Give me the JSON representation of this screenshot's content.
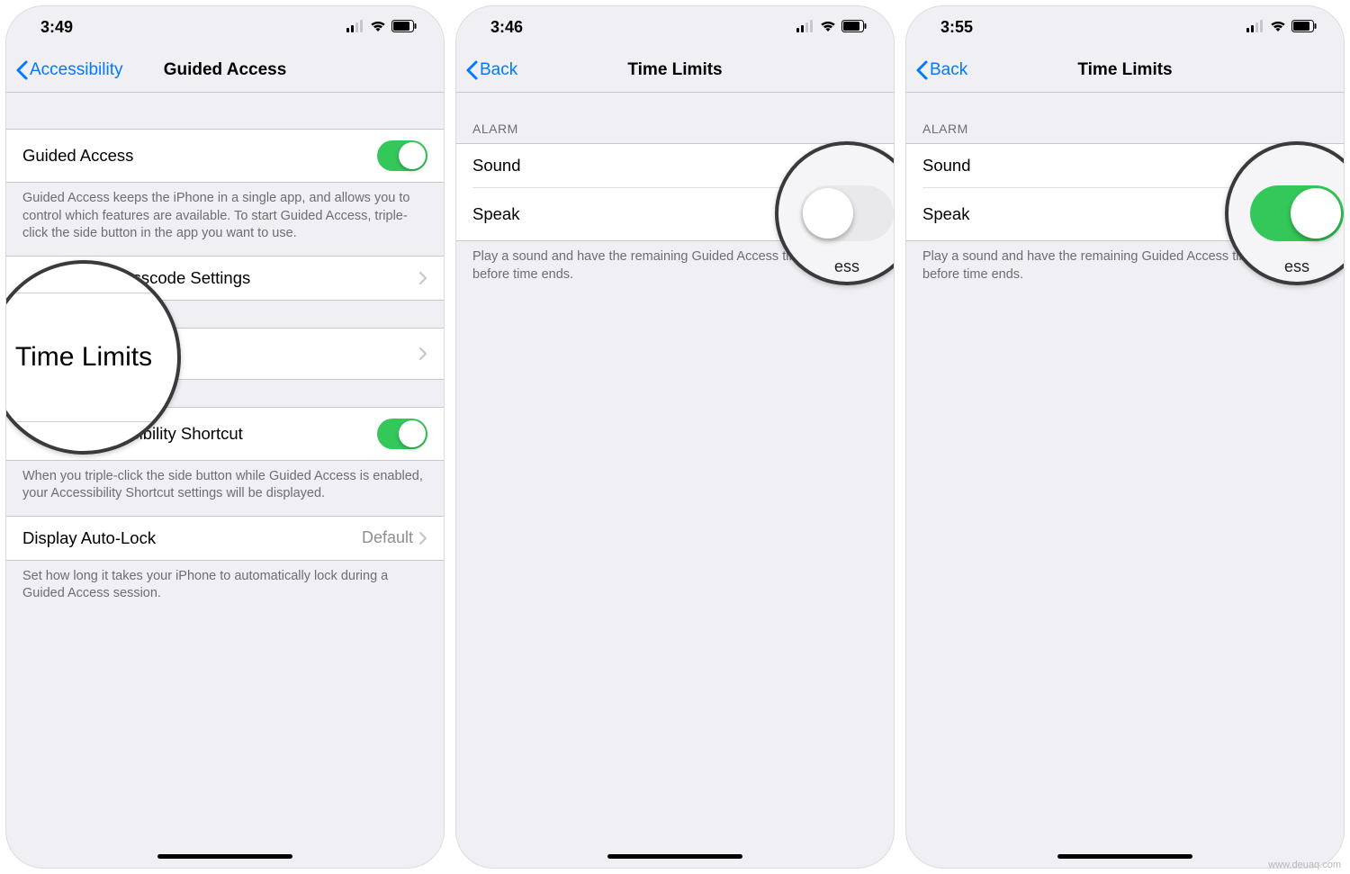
{
  "watermark": "www.deuaq.com",
  "screens": [
    {
      "status": {
        "time": "3:49"
      },
      "nav": {
        "back": "Accessibility",
        "title": "Guided Access"
      },
      "group1": {
        "toggle_label": "Guided Access",
        "toggle_on": true,
        "footer": "Guided Access keeps the iPhone in a single app, and allows you to control which features are available. To start Guided Access, triple-click the side button in the app you want to use."
      },
      "group2": {
        "item1": "Passcode Settings",
        "item2": "Time Limits"
      },
      "group3": {
        "toggle_label": "Accessibility Shortcut",
        "toggle_on": true,
        "footer": "When you triple-click the side button while Guided Access is enabled, your Accessibility Shortcut settings will be displayed."
      },
      "group4": {
        "label": "Display Auto-Lock",
        "value": "Default",
        "footer": "Set how long it takes your iPhone to automatically lock during a Guided Access session."
      },
      "magnifier": "Time Limits"
    },
    {
      "status": {
        "time": "3:46"
      },
      "nav": {
        "back": "Back",
        "title": "Time Limits"
      },
      "section_header": "ALARM",
      "items": {
        "sound": "Sound",
        "speak": "Speak",
        "speak_on": false
      },
      "footer": "Play a sound and have the remaining Guided Access time spoken before time ends.",
      "mag_edge_top": "",
      "mag_edge_bottom": "ess"
    },
    {
      "status": {
        "time": "3:55"
      },
      "nav": {
        "back": "Back",
        "title": "Time Limits"
      },
      "section_header": "ALARM",
      "items": {
        "sound": "Sound",
        "speak": "Speak",
        "speak_on": true
      },
      "footer": "Play a sound and have the remaining Guided Access time spoken before time ends.",
      "mag_edge_top": "",
      "mag_edge_bottom": "ess"
    }
  ]
}
